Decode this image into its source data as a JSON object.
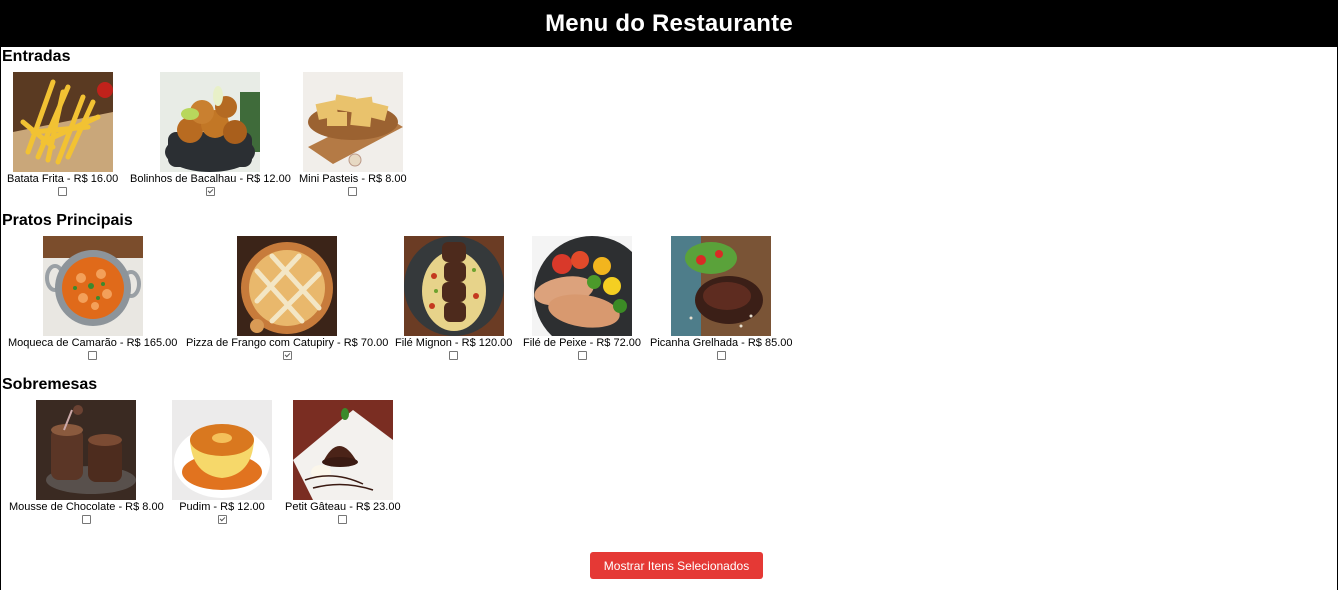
{
  "header": {
    "title": "Menu do Restaurante"
  },
  "sections": [
    {
      "title": "Entradas",
      "items": [
        {
          "label": "Batata Frita - R$ 16.00",
          "checked": false,
          "icon": "fries-image"
        },
        {
          "label": "Bolinhos de Bacalhau - R$ 12.00",
          "checked": true,
          "icon": "codfish-balls-image"
        },
        {
          "label": "Mini Pasteis - R$ 8.00",
          "checked": false,
          "icon": "pasteis-image"
        }
      ]
    },
    {
      "title": "Pratos Principais",
      "items": [
        {
          "label": "Moqueca de Camarão - R$ 165.00",
          "checked": false,
          "icon": "moqueca-image"
        },
        {
          "label": "Pizza de Frango com Catupiry - R$ 70.00",
          "checked": true,
          "icon": "pizza-image"
        },
        {
          "label": "Filé Mignon - R$ 120.00",
          "checked": false,
          "icon": "filet-mignon-image"
        },
        {
          "label": "Filé de Peixe - R$ 72.00",
          "checked": false,
          "icon": "fish-filet-image"
        },
        {
          "label": "Picanha Grelhada - R$ 85.00",
          "checked": false,
          "icon": "picanha-image"
        }
      ]
    },
    {
      "title": "Sobremesas",
      "items": [
        {
          "label": "Mousse de Chocolate - R$ 8.00",
          "checked": false,
          "icon": "chocolate-mousse-image"
        },
        {
          "label": "Pudim - R$ 12.00",
          "checked": true,
          "icon": "pudim-image"
        },
        {
          "label": "Petit Gâteau - R$ 23.00",
          "checked": false,
          "icon": "petit-gateau-image"
        }
      ]
    }
  ],
  "button": {
    "label": "Mostrar Itens Selecionados"
  },
  "colors": {
    "header_bg": "#000000",
    "button_bg": "#e53935"
  }
}
